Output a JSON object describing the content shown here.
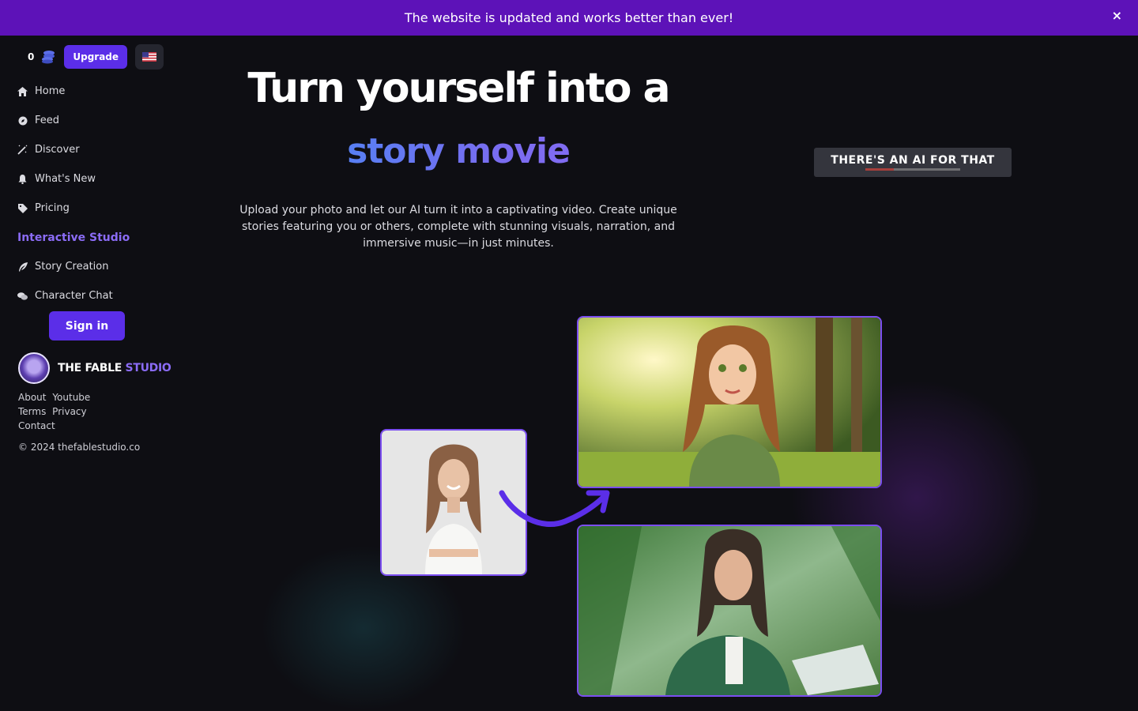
{
  "banner": {
    "message": "The website is updated and works better than ever!",
    "close_label": "×"
  },
  "topbar": {
    "coins": "0",
    "upgrade_label": "Upgrade",
    "language_flag": "us-flag"
  },
  "nav": {
    "items": [
      {
        "label": "Home",
        "icon": "home-icon"
      },
      {
        "label": "Feed",
        "icon": "feed-icon"
      },
      {
        "label": "Discover",
        "icon": "magic-wand-icon"
      },
      {
        "label": "What's New",
        "icon": "bell-icon"
      },
      {
        "label": "Pricing",
        "icon": "tag-icon"
      }
    ],
    "section_heading": "Interactive Studio",
    "studio_items": [
      {
        "label": "Story Creation",
        "icon": "feather-icon"
      },
      {
        "label": "Character Chat",
        "icon": "chat-icon"
      }
    ]
  },
  "auth": {
    "sign_in_label": "Sign in"
  },
  "brand": {
    "name_part1": "THE FABLE",
    "name_part2": "STUDIO"
  },
  "footer": {
    "links_row1": [
      "About",
      "Youtube"
    ],
    "links_row2": [
      "Terms",
      "Privacy"
    ],
    "links_row3": [
      "Contact"
    ],
    "copyright": "© 2024 thefablestudio.co"
  },
  "hero": {
    "title": "Turn yourself into a",
    "accent": "story movie",
    "description": "Upload your photo and let our AI turn it into a captivating video. Create unique stories featuring you or others, complete with stunning visuals, narration, and immersive music—in just minutes."
  },
  "badge": {
    "text": "THERE'S AN AI FOR THAT"
  },
  "colors": {
    "banner": "#5d12b8",
    "accent": "#5b2ee8",
    "heading": "#8b6cf6",
    "background": "#0e0e13"
  }
}
